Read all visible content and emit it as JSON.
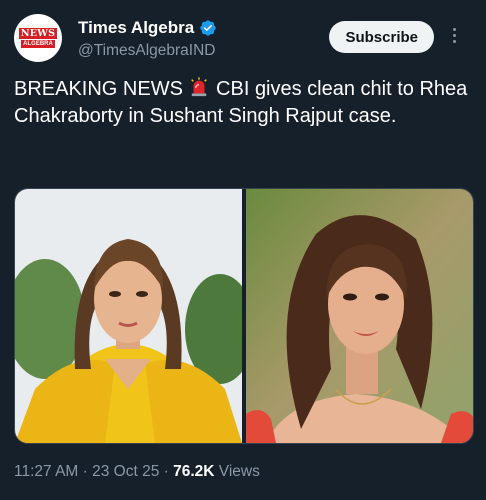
{
  "account": {
    "display_name": "Times Algebra",
    "handle": "@TimesAlgebraIND",
    "logo_text_top": "NEWS",
    "logo_text_bottom": "ALGEBRA"
  },
  "actions": {
    "subscribe_label": "Subscribe"
  },
  "tweet": {
    "text_before_emoji": "BREAKING NEWS ",
    "emoji_icon": "police-light-icon",
    "text_after_emoji": " CBI gives clean chit to Rhea Chakraborty in Sushant Singh Rajput case."
  },
  "meta": {
    "time": "11:27 AM",
    "sep1": " · ",
    "date": "23 Oct 25",
    "sep2": " · ",
    "views_count": "76.2K",
    "views_label": " Views"
  },
  "colors": {
    "background": "#15202b",
    "verified": "#1d9bf0",
    "muted": "#8b98a5",
    "logo_red": "#d81f26"
  }
}
